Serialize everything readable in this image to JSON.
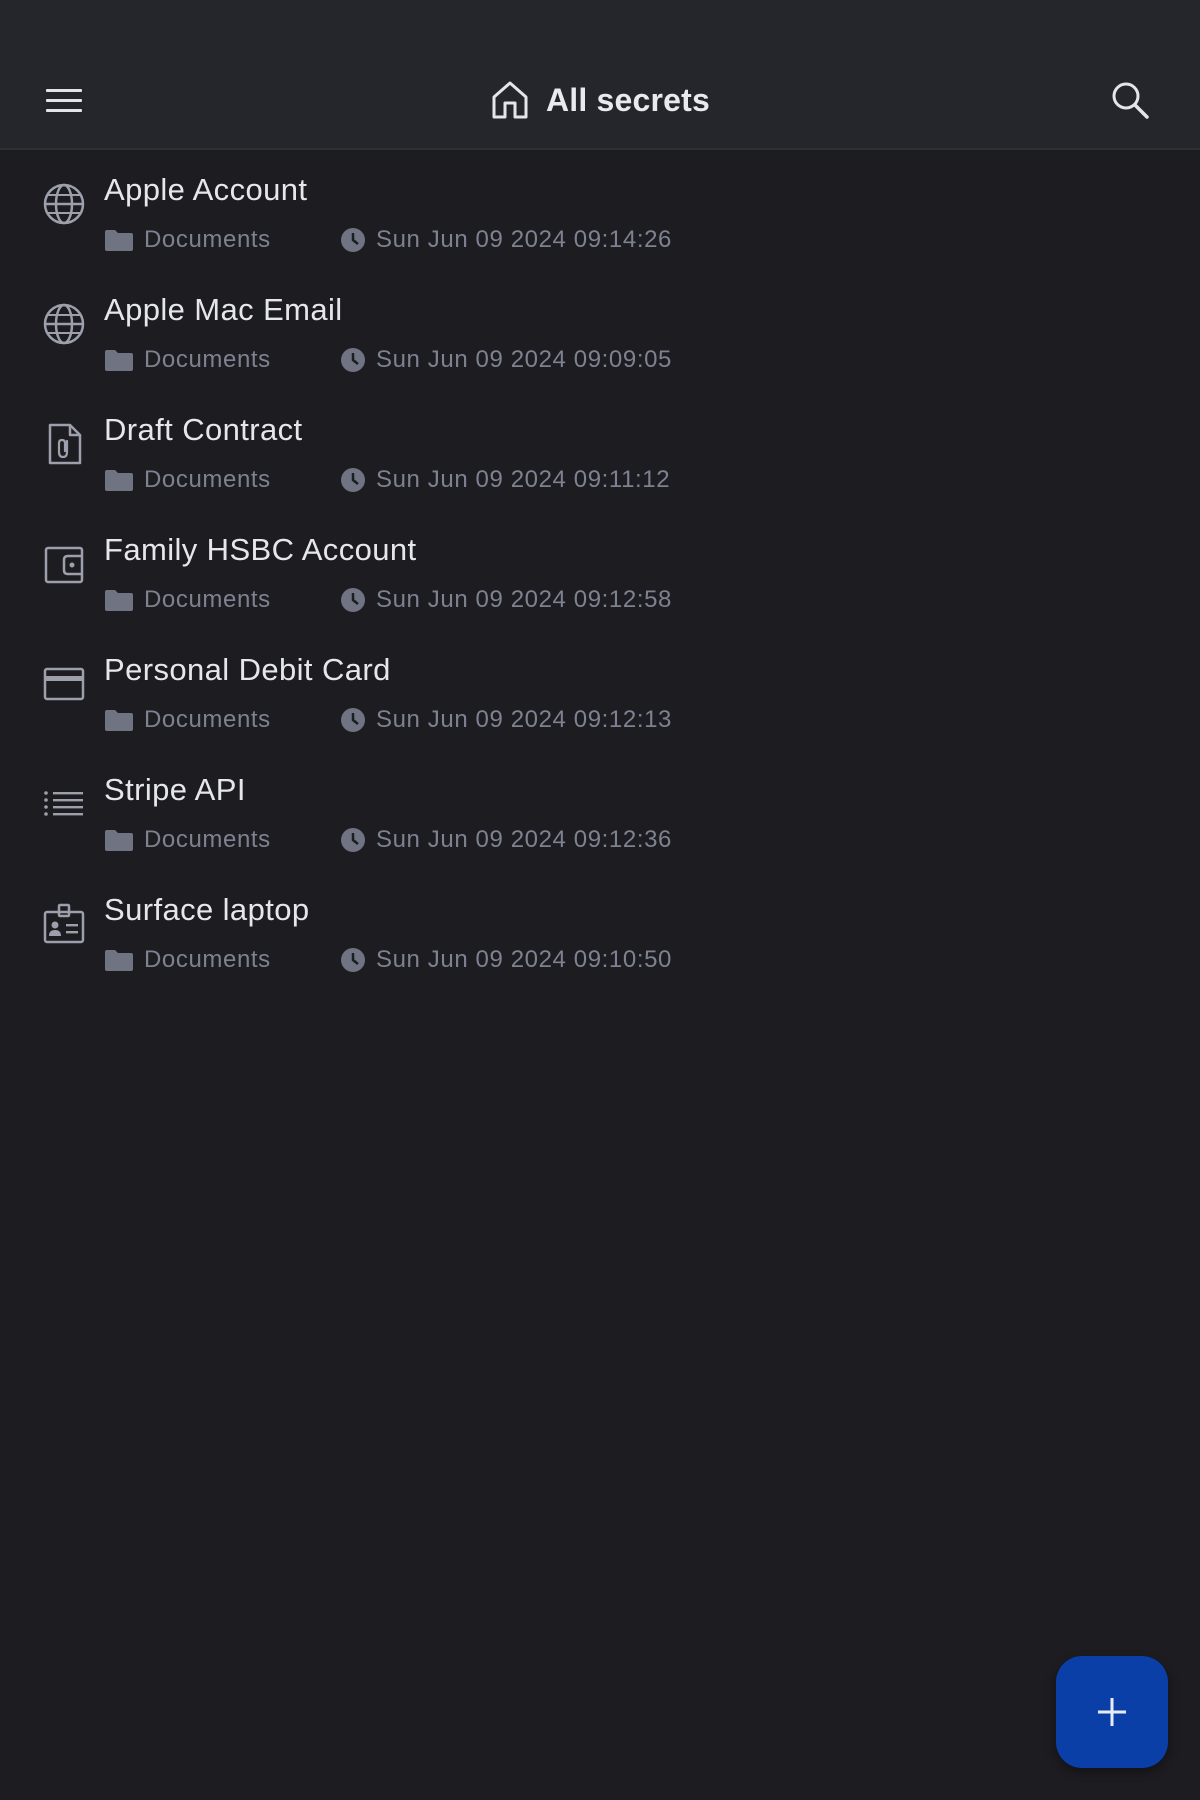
{
  "header": {
    "title": "All secrets",
    "menu_icon": "hamburger-menu-icon",
    "title_icon": "home-icon",
    "search_icon": "search-icon"
  },
  "colors": {
    "header_bg": "#25262b",
    "page_bg": "#1c1c21",
    "title_text": "#e6e7ec",
    "meta_text": "#7e8290",
    "fab_bg": "#0a3fa8"
  },
  "secrets": [
    {
      "title": "Apple Account",
      "folder": "Documents",
      "date": "Sun Jun 09 2024 09:14:26",
      "icon": "globe-icon"
    },
    {
      "title": "Apple Mac Email",
      "folder": "Documents",
      "date": "Sun Jun 09 2024 09:09:05",
      "icon": "globe-icon"
    },
    {
      "title": "Draft Contract",
      "folder": "Documents",
      "date": "Sun Jun 09 2024 09:11:12",
      "icon": "file-attachment-icon"
    },
    {
      "title": "Family HSBC Account",
      "folder": "Documents",
      "date": "Sun Jun 09 2024 09:12:58",
      "icon": "wallet-icon"
    },
    {
      "title": "Personal Debit Card",
      "folder": "Documents",
      "date": "Sun Jun 09 2024 09:12:13",
      "icon": "credit-card-icon"
    },
    {
      "title": "Stripe API",
      "folder": "Documents",
      "date": "Sun Jun 09 2024 09:12:36",
      "icon": "list-icon"
    },
    {
      "title": "Surface laptop",
      "folder": "Documents",
      "date": "Sun Jun 09 2024 09:10:50",
      "icon": "id-badge-icon"
    }
  ],
  "fab": {
    "icon": "plus-icon"
  }
}
